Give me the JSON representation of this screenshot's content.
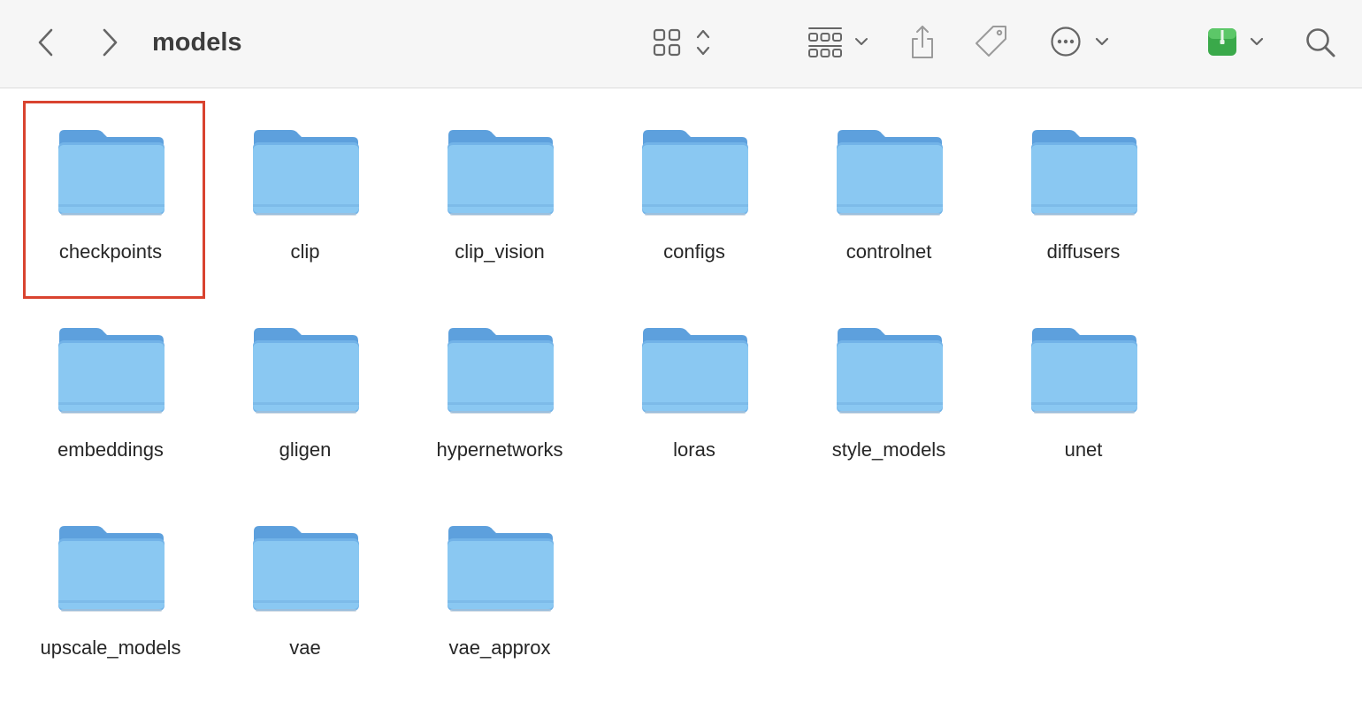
{
  "window": {
    "title": "models"
  },
  "toolbar": {
    "back_icon": "chevron-left-icon",
    "forward_icon": "chevron-right-icon",
    "view_icon": "icon-grid-view-icon",
    "group_icon": "group-by-icon",
    "share_icon": "share-icon",
    "tag_icon": "tag-icon",
    "more_icon": "ellipsis-circle-icon",
    "extension_icon": "archive-app-icon",
    "search_icon": "magnifying-glass-icon"
  },
  "colors": {
    "folder_body": "#8ac8f2",
    "folder_tab": "#5da0dd",
    "highlight_border": "#d9432f",
    "toolbar_bg": "#f6f6f6",
    "extension_green": "#3aa94a"
  },
  "folders": [
    {
      "name": "checkpoints",
      "selected": true
    },
    {
      "name": "clip"
    },
    {
      "name": "clip_vision"
    },
    {
      "name": "configs"
    },
    {
      "name": "controlnet"
    },
    {
      "name": "diffusers"
    },
    {
      "name": "embeddings"
    },
    {
      "name": "gligen"
    },
    {
      "name": "hypernetworks"
    },
    {
      "name": "loras"
    },
    {
      "name": "style_models"
    },
    {
      "name": "unet"
    },
    {
      "name": "upscale_models"
    },
    {
      "name": "vae"
    },
    {
      "name": "vae_approx"
    }
  ]
}
